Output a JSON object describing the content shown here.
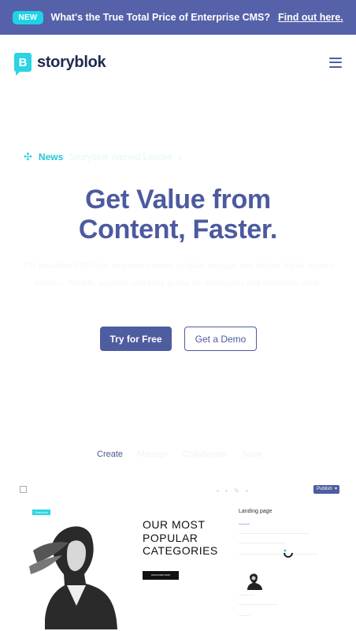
{
  "banner": {
    "badge": "NEW",
    "text": "What's the True Total Price of Enterprise CMS?",
    "link": "Find out here."
  },
  "nav": {
    "logo_letter": "B",
    "logo_text": "storyblok"
  },
  "news": {
    "label": "News",
    "text": "Storyblok named Leader",
    "arrow": "›"
  },
  "hero": {
    "title_line1": "Get Value from",
    "title_line2": "Content, Faster.",
    "subtitle": "The headless CMS that empowers teams to build, manage and deliver digital content faster — flexible, scalable and easy to use for developers and marketers alike.",
    "cta_primary": "Try for Free",
    "cta_secondary": "Get a Demo"
  },
  "tabs": {
    "active": "Create",
    "items": [
      "Manage",
      "Collaborate",
      "Scale"
    ]
  },
  "preview": {
    "publish": "Publish",
    "caret": "▾",
    "tag": "Storyblok",
    "category_line1": "OUR MOST",
    "category_line2": "POPULAR",
    "category_line3": "CATEGORIES",
    "category_button": "DISCOVER NOW",
    "panel_title": "Landing page"
  },
  "colors": {
    "brand": "#5561a8",
    "accent": "#2bd3e3",
    "title": "#4c5a9f"
  }
}
